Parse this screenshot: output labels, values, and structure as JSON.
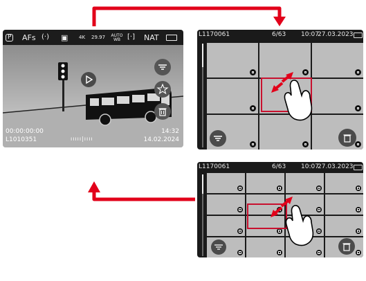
{
  "live_view": {
    "status_icons": [
      "P",
      "AFs",
      "(·)",
      "▣",
      "4K",
      "29.97",
      "AUTO WB",
      "[·]",
      "NAT",
      "battery-icon"
    ],
    "timecode": "00:00:00:00",
    "clip_id": "L1010351",
    "time": "14:32",
    "date": "14.02.2024",
    "scale_glyphs": "ııııı|ıııı",
    "side_icons": [
      "menu-icon",
      "star-icon",
      "trash-icon"
    ]
  },
  "grid3": {
    "file_name": "L1170061",
    "counter": "6/63",
    "time": "10:07",
    "date": "27.03.2023"
  },
  "grid4": {
    "file_name": "L1170061",
    "counter": "6/63",
    "time": "10:07",
    "date": "27.03.2023"
  },
  "colors": {
    "arrow": "#e2001a",
    "selection": "#c8102e",
    "screen_bg": "#1a1a1a",
    "cell": "#bdbdbd"
  }
}
